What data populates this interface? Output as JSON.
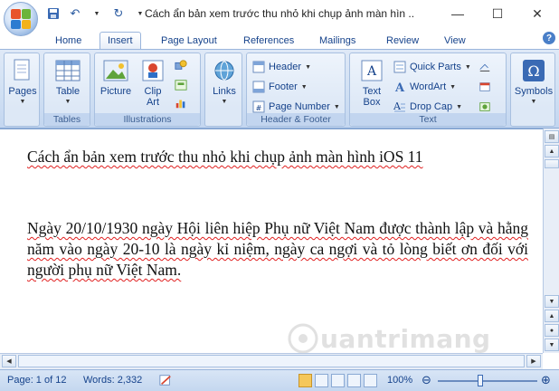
{
  "window": {
    "title": "Cách ẩn bản xem trước thu nhỏ khi chụp ảnh màn hìn ..",
    "minimize": "—",
    "maximize": "☐",
    "close": "✕"
  },
  "tabs": [
    "Home",
    "Insert",
    "Page Layout",
    "References",
    "Mailings",
    "Review",
    "View"
  ],
  "active_tab": "Insert",
  "ribbon": {
    "pages": "Pages",
    "tables": {
      "table": "Table",
      "group": "Tables"
    },
    "illustrations": {
      "picture": "Picture",
      "clipart": "Clip Art",
      "group": "Illustrations"
    },
    "links": "Links",
    "header_footer": {
      "header": "Header",
      "footer": "Footer",
      "page_number": "Page Number",
      "group": "Header & Footer"
    },
    "text": {
      "text_box": "Text Box",
      "quick_parts": "Quick Parts",
      "wordart": "WordArt",
      "drop_cap": "Drop Cap",
      "group": "Text"
    },
    "symbols": "Symbols"
  },
  "document": {
    "title_line": "Cách ẩn bản xem trước thu nhỏ khi chụp ảnh màn hình iOS 11",
    "paragraph": "Ngày 20/10/1930 ngày Hội liên hiệp Phụ nữ Việt Nam được thành lập và hằng năm vào ngày 20-10 là ngày kỉ niệm, ngày ca ngợi và tỏ lòng biết ơn đối với người phụ nữ Việt Nam."
  },
  "status": {
    "page": "Page: 1 of 12",
    "words": "Words: 2,332",
    "zoom": "100%"
  },
  "watermark": "uantrimang",
  "colors": {
    "accent": "#15428b",
    "ribbon": "#dfe9f7",
    "statusbar": "#c4d7ef"
  }
}
